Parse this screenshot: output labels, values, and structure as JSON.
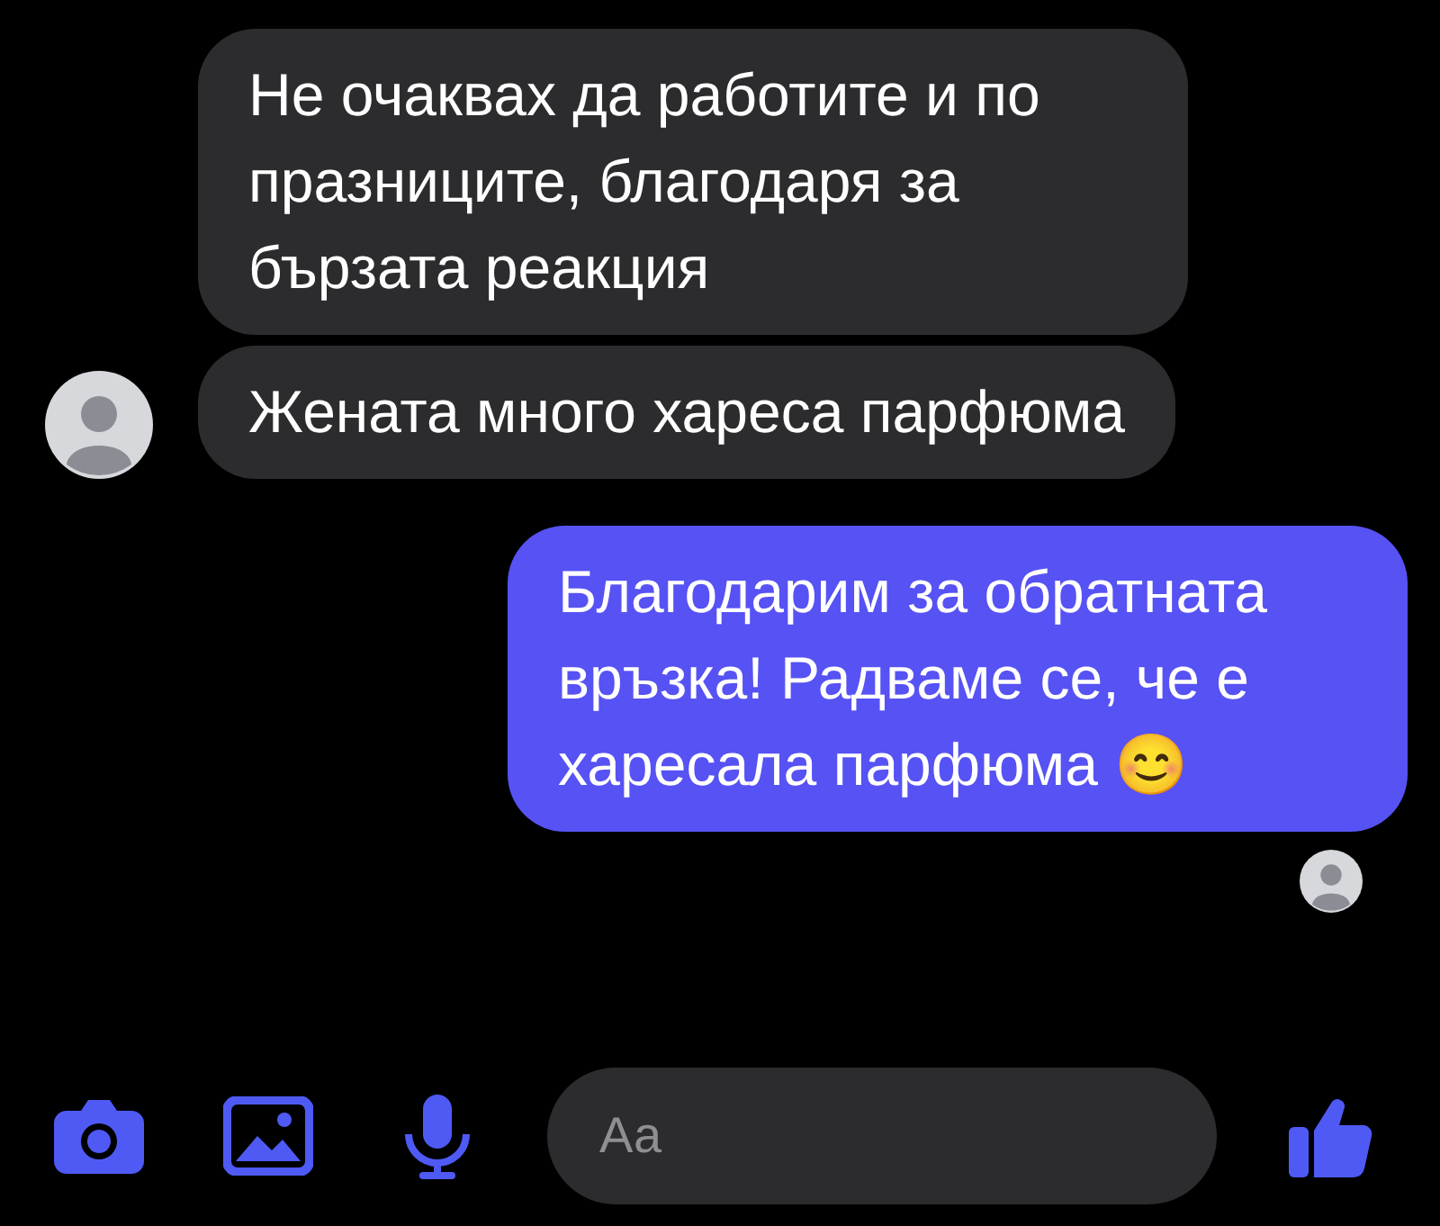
{
  "messages": [
    {
      "kind": "incoming",
      "text": "Не очаквах да работите и по празниците, благодаря за бързата реакция",
      "avatar": false
    },
    {
      "kind": "incoming",
      "text": "Жената много хареса парфюма",
      "avatar": true
    },
    {
      "kind": "outgoing",
      "text": "Благодарим за обратната връзка! Радваме се, че е харесала парфюма 😊",
      "seen": true
    }
  ],
  "composer": {
    "placeholder": "Аа"
  }
}
